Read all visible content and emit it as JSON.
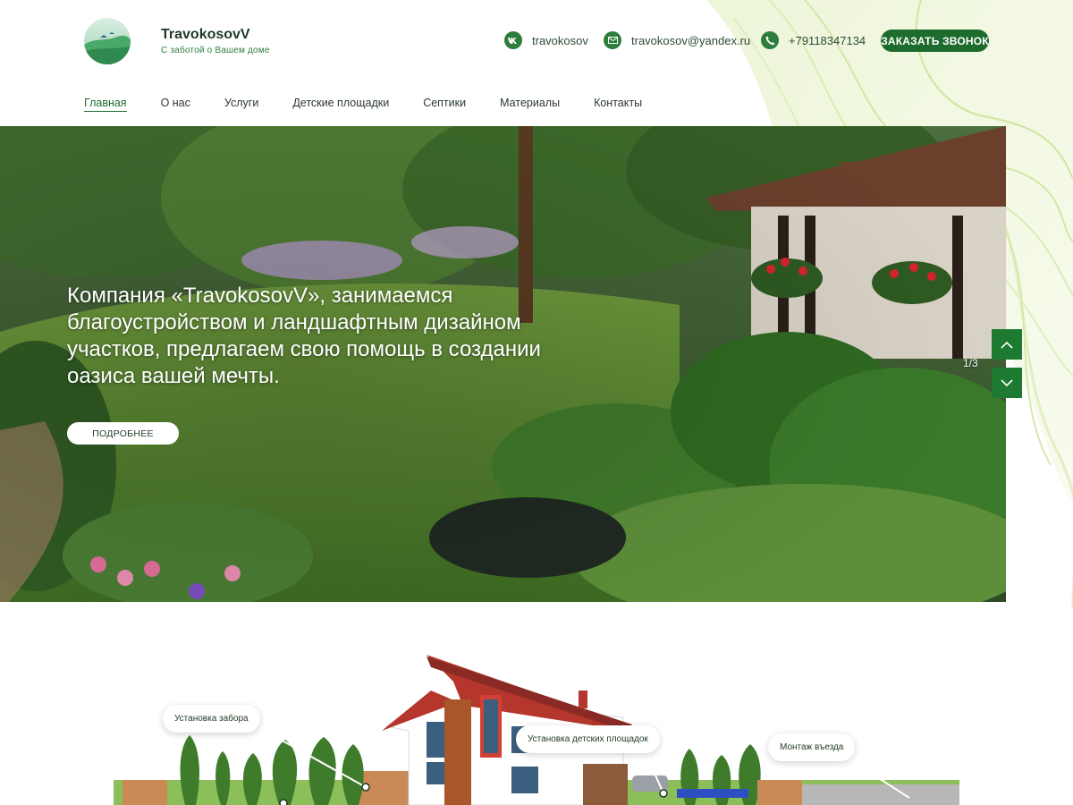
{
  "brand": {
    "name": "TravokosovV",
    "tagline": "С заботой о Вашем доме"
  },
  "contacts": {
    "vk": {
      "icon": "vk-icon",
      "label": "travokosov"
    },
    "email": {
      "icon": "mail-icon",
      "label": "travokosov@yandex.ru"
    },
    "phone": {
      "icon": "phone-icon",
      "label": "+79118347134"
    }
  },
  "call_button": "ЗАКАЗАТЬ ЗВОНОК",
  "nav": {
    "items": [
      {
        "label": "Главная",
        "active": true
      },
      {
        "label": "О нас"
      },
      {
        "label": "Услуги"
      },
      {
        "label": "Детские площадки"
      },
      {
        "label": "Септики"
      },
      {
        "label": "Материалы"
      },
      {
        "label": "Контакты"
      }
    ]
  },
  "hero": {
    "headline": "Компания «TravokosovV», занимаемся благоустройством и ландшафтным дизайном участков, предлагаем свою помощь в создании оазиса вашей мечты.",
    "button": "ПОДРОБНЕЕ",
    "counter": "1/3"
  },
  "services_tags": {
    "fence": "Установка забора",
    "playground": "Установка детских площадок",
    "driveway": "Монтаж въезда"
  },
  "colors": {
    "accent": "#1e6b2e",
    "accent_light": "#2e7d3d"
  }
}
